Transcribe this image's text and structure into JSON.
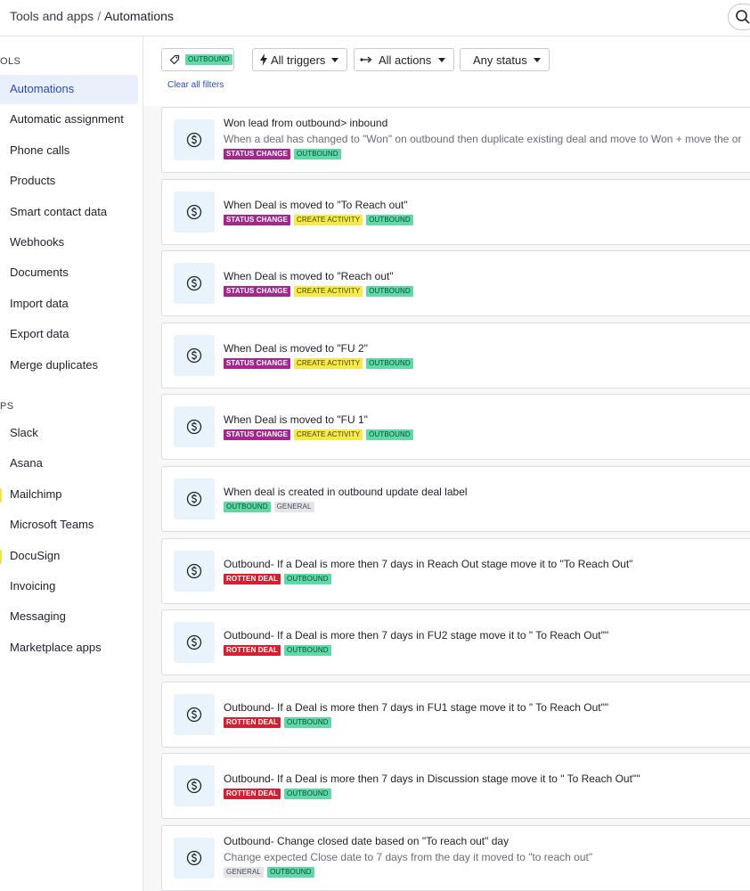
{
  "header": {
    "breadcrumb_parent": "Tools and apps",
    "breadcrumb_separator": "/",
    "breadcrumb_current": "Automations"
  },
  "sidebar": {
    "tools_title": "OLS",
    "tools": [
      {
        "label": "Automations",
        "active": true
      },
      {
        "label": "Automatic assignment"
      },
      {
        "label": "Phone calls"
      },
      {
        "label": "Products"
      },
      {
        "label": "Smart contact data"
      },
      {
        "label": "Webhooks"
      },
      {
        "label": "Documents"
      },
      {
        "label": "Import data"
      },
      {
        "label": "Export data"
      },
      {
        "label": "Merge duplicates"
      }
    ],
    "apps_title": "PS",
    "apps": [
      {
        "label": "Slack"
      },
      {
        "label": "Asana"
      },
      {
        "label": "Mailchimp",
        "marker_color": "#f2e34c"
      },
      {
        "label": "Microsoft Teams"
      },
      {
        "label": "DocuSign",
        "marker_color": "#f2e34c"
      },
      {
        "label": "Invoicing"
      },
      {
        "label": "Messaging"
      },
      {
        "label": "Marketplace apps"
      }
    ]
  },
  "filters": {
    "label_filter": "OUTBOUND",
    "triggers": "All triggers",
    "actions": "All actions",
    "status": "Any status",
    "clear": "Clear all filters"
  },
  "colors": {
    "status_change": "#a3278f",
    "create_activity": "#f5ea49",
    "outbound": "#5fd9a8",
    "general": "#e4e5e9",
    "rotten_deal": "#d42030",
    "link": "#2a4bbf"
  },
  "automations": [
    {
      "title": "Won lead from outbound> inbound",
      "description": "When a deal has changed to \"Won\" on outbound then duplicate existing deal and move to Won + move the or",
      "tags": [
        {
          "text": "STATUS CHANGE",
          "kind": "status"
        },
        {
          "text": "OUTBOUND",
          "kind": "outbound"
        }
      ]
    },
    {
      "title": "When Deal is moved to \"To Reach out\"",
      "description": "",
      "tags": [
        {
          "text": "STATUS CHANGE",
          "kind": "status"
        },
        {
          "text": "CREATE ACTIVITY",
          "kind": "activity"
        },
        {
          "text": "OUTBOUND",
          "kind": "outbound"
        }
      ]
    },
    {
      "title": "When Deal is moved to \"Reach out\"",
      "description": "",
      "tags": [
        {
          "text": "STATUS CHANGE",
          "kind": "status"
        },
        {
          "text": "CREATE ACTIVITY",
          "kind": "activity"
        },
        {
          "text": "OUTBOUND",
          "kind": "outbound"
        }
      ]
    },
    {
      "title": "When Deal is moved to \"FU 2\"",
      "description": "",
      "tags": [
        {
          "text": "STATUS CHANGE",
          "kind": "status"
        },
        {
          "text": "CREATE ACTIVITY",
          "kind": "activity"
        },
        {
          "text": "OUTBOUND",
          "kind": "outbound"
        }
      ]
    },
    {
      "title": "When Deal is moved to \"FU 1\"",
      "description": "",
      "tags": [
        {
          "text": "STATUS CHANGE",
          "kind": "status"
        },
        {
          "text": "CREATE ACTIVITY",
          "kind": "activity"
        },
        {
          "text": "OUTBOUND",
          "kind": "outbound"
        }
      ]
    },
    {
      "title": "When deal is created in outbound update deal label",
      "description": "",
      "tags": [
        {
          "text": "OUTBOUND",
          "kind": "outbound"
        },
        {
          "text": "GENERAL",
          "kind": "general"
        }
      ]
    },
    {
      "title": "Outbound- If a Deal is more then 7 days in Reach Out stage move it to \"To Reach Out\"",
      "description": "",
      "tags": [
        {
          "text": "ROTTEN DEAL",
          "kind": "rotten"
        },
        {
          "text": "OUTBOUND",
          "kind": "outbound"
        }
      ]
    },
    {
      "title": "Outbound- If a Deal is more then 7 days in FU2 stage move it to \" To Reach Out\"\"",
      "description": "",
      "tags": [
        {
          "text": "ROTTEN DEAL",
          "kind": "rotten"
        },
        {
          "text": "OUTBOUND",
          "kind": "outbound"
        }
      ]
    },
    {
      "title": "Outbound- If a Deal is more then 7 days in FU1 stage move it to \" To Reach Out\"\"",
      "description": "",
      "tags": [
        {
          "text": "ROTTEN DEAL",
          "kind": "rotten"
        },
        {
          "text": "OUTBOUND",
          "kind": "outbound"
        }
      ]
    },
    {
      "title": "Outbound- If a Deal is more then 7 days in Discussion stage move it to \" To Reach Out\"\"",
      "description": "",
      "tags": [
        {
          "text": "ROTTEN DEAL",
          "kind": "rotten"
        },
        {
          "text": "OUTBOUND",
          "kind": "outbound"
        }
      ]
    },
    {
      "title": "Outbound- Change closed date based on \"To reach out\" day",
      "description": "Change expected Close date to 7 days from the day it moved to \"to reach out\"",
      "tags": [
        {
          "text": "GENERAL",
          "kind": "general"
        },
        {
          "text": "OUTBOUND",
          "kind": "outbound"
        }
      ]
    }
  ]
}
